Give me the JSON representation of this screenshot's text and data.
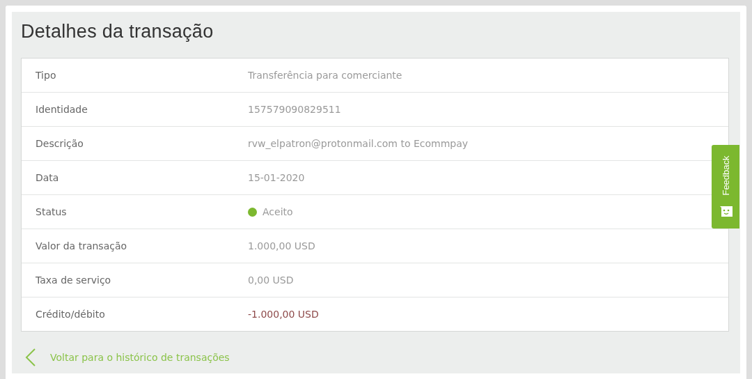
{
  "title": "Detalhes da transação",
  "rows": [
    {
      "kind": "text",
      "label": "Tipo",
      "value": "Transferência para comerciante"
    },
    {
      "kind": "text",
      "label": "Identidade",
      "value": "157579090829511"
    },
    {
      "kind": "text",
      "label": "Descrição",
      "value": "rvw_elpatron@protonmail.com to Ecommpay"
    },
    {
      "kind": "text",
      "label": "Data",
      "value": "15-01-2020"
    },
    {
      "kind": "status",
      "label": "Status",
      "value": "Aceito",
      "color": "#7cb82f"
    },
    {
      "kind": "text",
      "label": "Valor da transação",
      "value": "1.000,00 USD"
    },
    {
      "kind": "text",
      "label": "Taxa de serviço",
      "value": "0,00 USD"
    },
    {
      "kind": "debit",
      "label": "Crédito/débito",
      "value": "-1.000,00 USD"
    }
  ],
  "back_link": "Voltar para o histórico de transações",
  "feedback_tab": "Feedback"
}
